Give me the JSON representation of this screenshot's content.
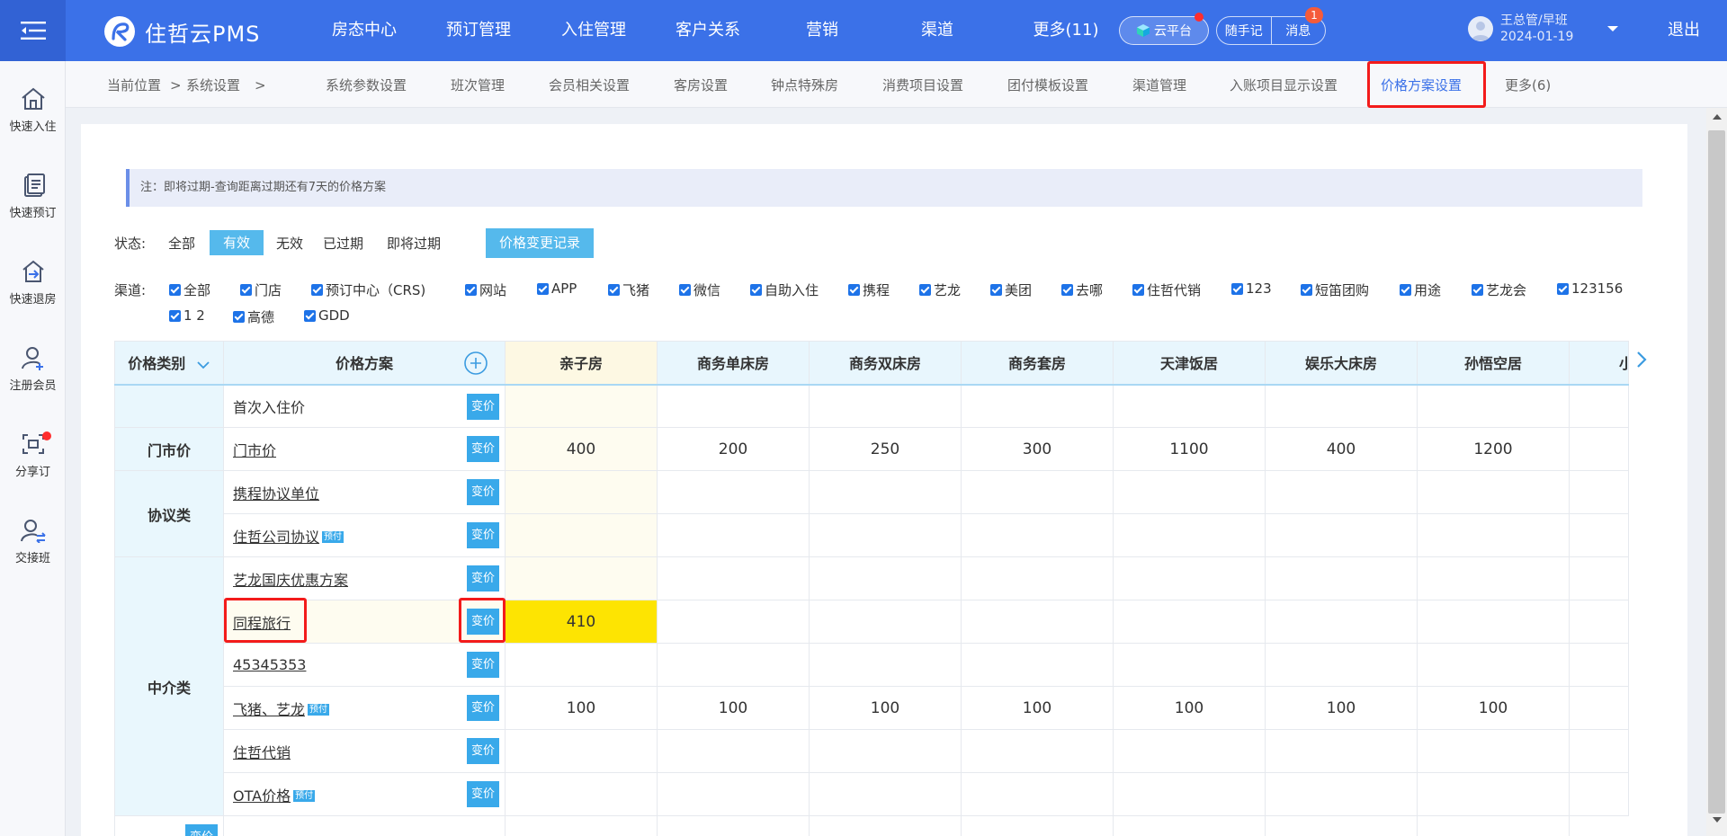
{
  "brand": {
    "name": "住哲云PMS"
  },
  "nav": [
    "房态中心",
    "预订管理",
    "入住管理",
    "客户关系",
    "营销",
    "渠道",
    "更多(11)"
  ],
  "header": {
    "cloud": "云平台",
    "memo": "随手记",
    "messages": "消息",
    "message_count": "1",
    "user_name": "王总管/早班",
    "user_date": "2024-01-19",
    "logout": "退出"
  },
  "sidebar": [
    "快速入住",
    "快速预订",
    "快速退房",
    "注册会员",
    "分享订",
    "交接班"
  ],
  "breadcrumb": {
    "current": "当前位置",
    "sep": ">",
    "system": "系统设置",
    "sep2": ">"
  },
  "tabs": [
    "系统参数设置",
    "班次管理",
    "会员相关设置",
    "客房设置",
    "钟点特殊房",
    "消费项目设置",
    "团付模板设置",
    "渠道管理",
    "入账项目显示设置",
    "价格方案设置",
    "更多(6)"
  ],
  "note": "注：即将过期-查询距离过期还有7天的价格方案",
  "status": {
    "label": "状态:",
    "options": [
      "全部",
      "有效",
      "无效",
      "已过期",
      "即将过期"
    ],
    "history_button": "价格变更记录"
  },
  "channels": {
    "label": "渠道:",
    "items": [
      "全部",
      "门店",
      "预订中心（CRS)",
      "网站",
      "APP",
      "飞猪",
      "微信",
      "自助入住",
      "携程",
      "艺龙",
      "美团",
      "去哪",
      "住哲代销",
      "123",
      "短笛团购",
      "用途",
      "艺龙会",
      "123156",
      "1 2",
      "高德",
      "GDD"
    ]
  },
  "table": {
    "col_category": "价格类别",
    "col_plan": "价格方案",
    "rooms": [
      "亲子房",
      "商务单床房",
      "商务双床房",
      "商务套房",
      "天津饭居",
      "娱乐大床房",
      "孙悟空居",
      "小"
    ],
    "change_label": "变价",
    "prepay_label": "预付",
    "categories": {
      "menshi": "门市价",
      "xieyi": "协议类",
      "zhongjie": "中介类"
    },
    "rows": [
      {
        "plan": "首次入住价",
        "link": false,
        "prices": [
          "",
          "",
          "",
          "",
          "",
          "",
          ""
        ]
      },
      {
        "plan": "门市价",
        "link": true,
        "prices": [
          "400",
          "200",
          "250",
          "300",
          "1100",
          "400",
          "1200"
        ]
      },
      {
        "plan": "携程协议单位",
        "link": true,
        "prices": [
          "",
          "",
          "",
          "",
          "",
          "",
          ""
        ]
      },
      {
        "plan": "住哲公司协议",
        "link": true,
        "prepay": true,
        "prices": [
          "",
          "",
          "",
          "",
          "",
          "",
          ""
        ]
      },
      {
        "plan": "艺龙国庆优惠方案",
        "link": true,
        "prices": [
          "",
          "",
          "",
          "",
          "",
          "",
          ""
        ]
      },
      {
        "plan": "同程旅行",
        "link": true,
        "prices": [
          "410",
          "",
          "",
          "",
          "",
          "",
          ""
        ]
      },
      {
        "plan": "45345353",
        "link": true,
        "prices": [
          "",
          "",
          "",
          "",
          "",
          "",
          ""
        ]
      },
      {
        "plan": "飞猪、艺龙",
        "link": true,
        "prepay": true,
        "prices": [
          "100",
          "100",
          "100",
          "100",
          "100",
          "100",
          "100"
        ]
      },
      {
        "plan": "住哲代销",
        "link": true,
        "prices": [
          "",
          "",
          "",
          "",
          "",
          "",
          ""
        ]
      },
      {
        "plan": "OTA价格",
        "link": true,
        "prepay": true,
        "prices": [
          "",
          "",
          "",
          "",
          "",
          "",
          ""
        ]
      }
    ]
  }
}
